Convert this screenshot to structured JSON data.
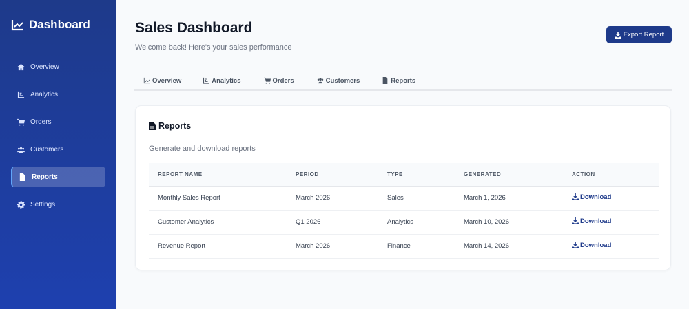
{
  "sidebar": {
    "brand": "Dashboard",
    "items": [
      {
        "label": "Overview"
      },
      {
        "label": "Analytics"
      },
      {
        "label": "Orders"
      },
      {
        "label": "Customers"
      },
      {
        "label": "Reports"
      },
      {
        "label": "Settings"
      }
    ]
  },
  "header": {
    "title": "Sales Dashboard",
    "subtitle": "Welcome back! Here's your sales performance",
    "export_label": "Export Report"
  },
  "tabs": [
    {
      "label": "Overview"
    },
    {
      "label": "Analytics"
    },
    {
      "label": "Orders"
    },
    {
      "label": "Customers"
    },
    {
      "label": "Reports"
    }
  ],
  "card": {
    "title": "Reports",
    "subtitle": "Generate and download reports",
    "columns": [
      "REPORT NAME",
      "PERIOD",
      "TYPE",
      "GENERATED",
      "ACTION"
    ],
    "rows": [
      {
        "name": "Monthly Sales Report",
        "period": "March 2026",
        "type": "Sales",
        "generated": "March 1, 2026",
        "action": "Download"
      },
      {
        "name": "Customer Analytics",
        "period": "Q1 2026",
        "type": "Analytics",
        "generated": "March 10, 2026",
        "action": "Download"
      },
      {
        "name": "Revenue Report",
        "period": "March 2026",
        "type": "Finance",
        "generated": "March 14, 2026",
        "action": "Download"
      }
    ]
  }
}
